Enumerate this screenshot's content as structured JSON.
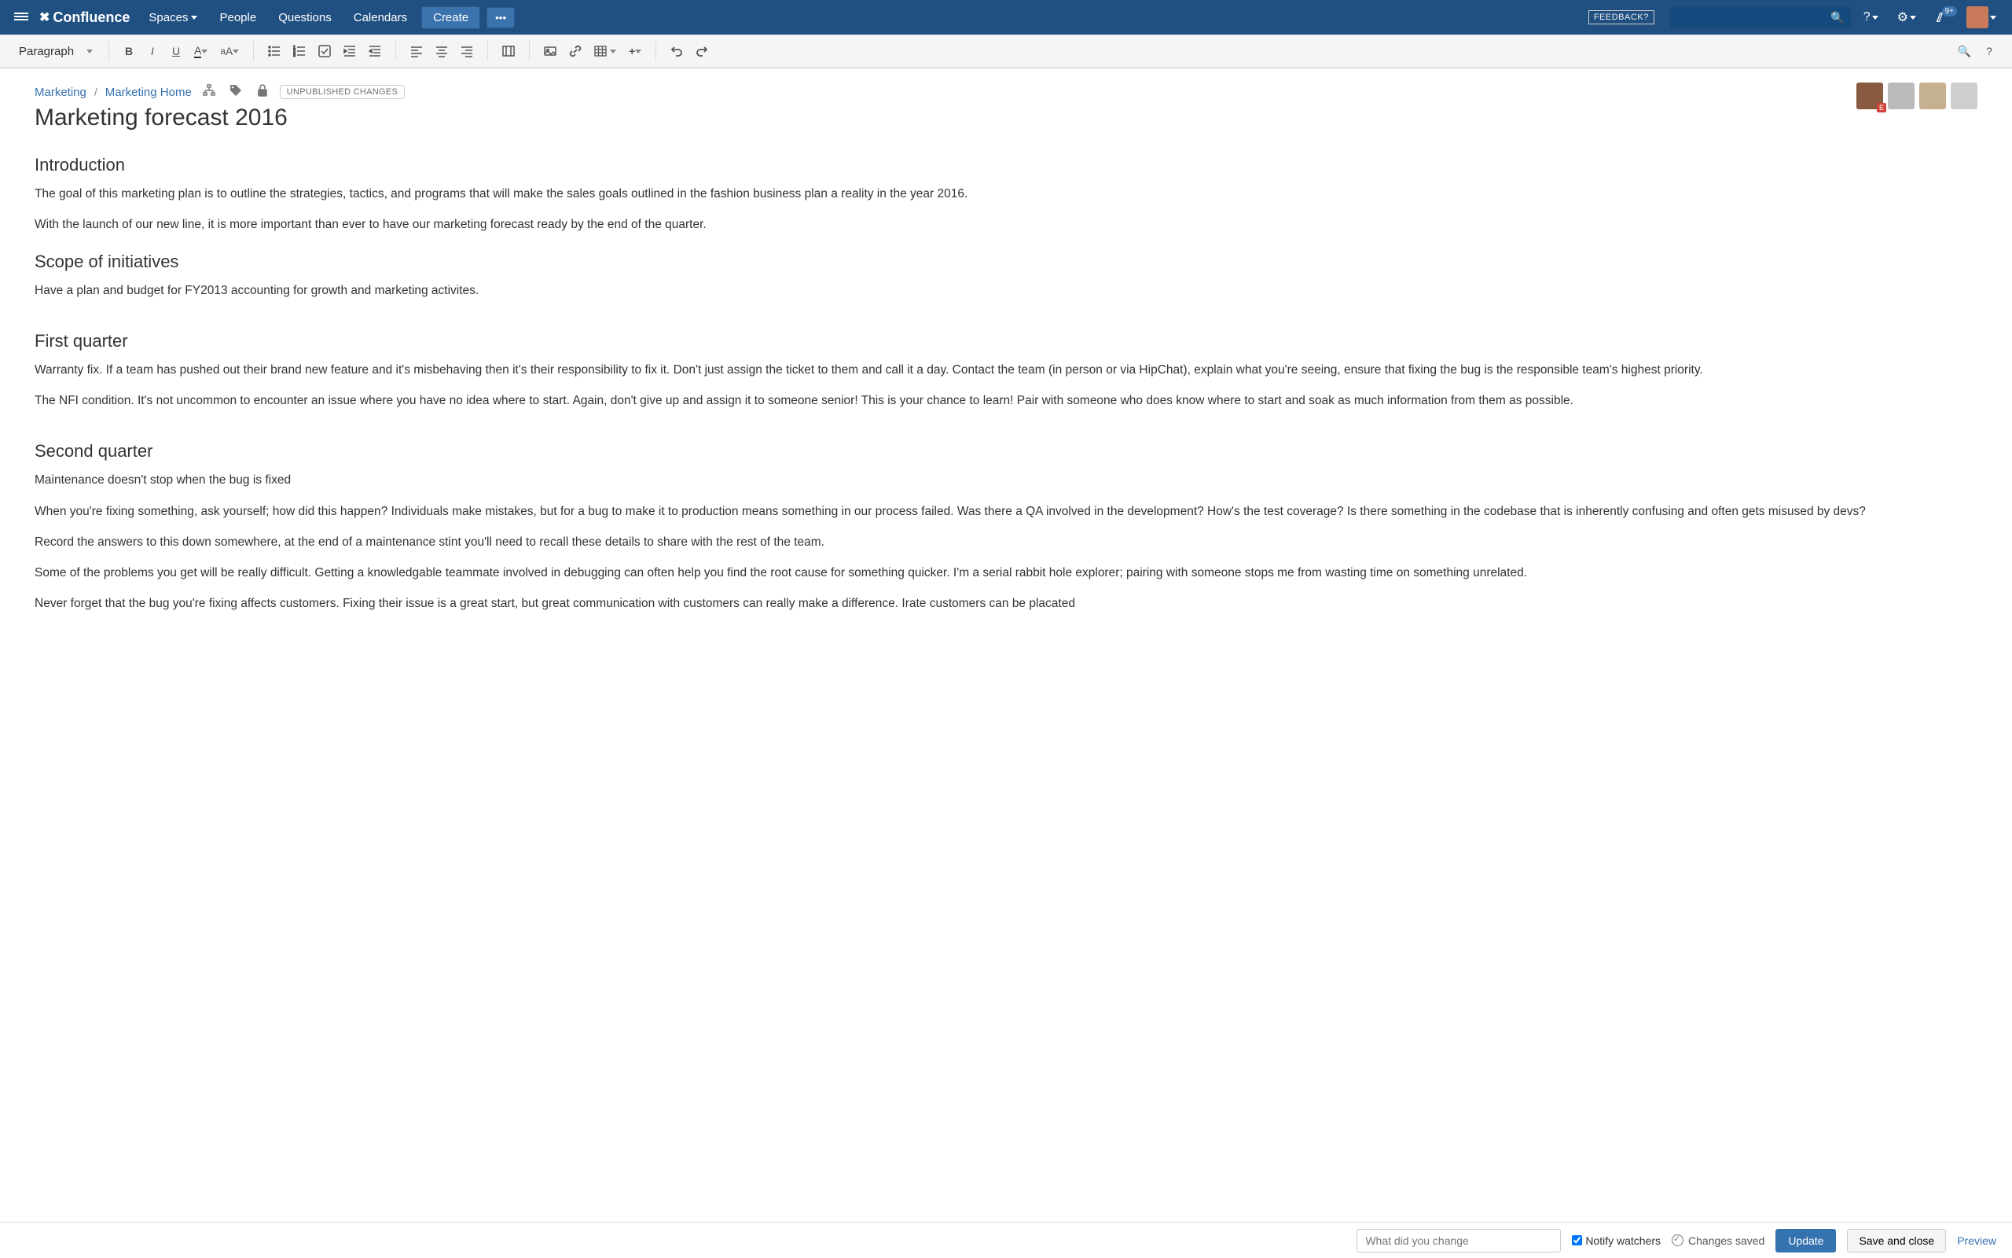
{
  "top": {
    "product": "Confluence",
    "nav": {
      "spaces": "Spaces",
      "people": "People",
      "questions": "Questions",
      "calendars": "Calendars"
    },
    "create": "Create",
    "feedback": "FEEDBACK?",
    "notif_badge": "9+"
  },
  "toolbar": {
    "format_label": "Paragraph"
  },
  "breadcrumb": {
    "space": "Marketing",
    "parent": "Marketing Home",
    "status": "UNPUBLISHED CHANGES"
  },
  "page": {
    "title": "Marketing forecast 2016",
    "intro_h": "Introduction",
    "intro_p1": "The goal of this marketing plan is to outline the strategies, tactics, and programs that will make the sales goals outlined in the fashion business plan a reality in the year 2016.",
    "intro_p2": "With the launch of our new line, it is more important than ever to have our marketing forecast ready by the end of the quarter.",
    "scope_h": "Scope of initiatives",
    "scope_p1": "Have a plan and budget for FY2013 accounting for growth and marketing activites.",
    "q1_h": "First quarter",
    "q1_p1": "Warranty fix. If a team has pushed out their brand new feature and it's misbehaving then it's their responsibility to fix it. Don't just assign the ticket to them and call it a day. Contact the team (in person or via HipChat), explain what you're seeing, ensure that fixing the bug is the responsible team's highest priority.",
    "q1_p2": "The NFI condition. It's not uncommon to encounter an issue where you have no idea where to start. Again, don't give up and assign it to someone senior! This is your chance to learn! Pair with someone who does know where to start and soak as much information from them as possible.",
    "q2_h": "Second quarter",
    "q2_p1": "Maintenance doesn't stop when the bug is fixed",
    "q2_p2": "When you're fixing something, ask yourself; how did this happen? Individuals make mistakes, but for a bug to make it to production means something in our process failed. Was there a QA involved in the development? How's the test coverage? Is there something in the codebase that is inherently confusing and often gets misused by devs?",
    "q2_p3": "Record the answers to this down somewhere, at the end of a maintenance stint you'll need to recall these details to share with the rest of the team.",
    "q2_p4": "Some of the problems you get will be really difficult. Getting a knowledgable teammate involved in debugging can often help you find the root cause for something quicker. I'm a serial rabbit hole explorer; pairing with someone stops me from wasting time on something unrelated.",
    "q2_p5": "Never forget that the bug you're fixing affects customers. Fixing their issue is a great start, but great communication with customers can really make a difference. Irate customers can be placated"
  },
  "bottom": {
    "change_placeholder": "What did you change",
    "notify": "Notify watchers",
    "saved": "Changes saved",
    "update": "Update",
    "saveclose": "Save and close",
    "preview": "Preview"
  },
  "collab": {
    "editor_badge": "E"
  }
}
